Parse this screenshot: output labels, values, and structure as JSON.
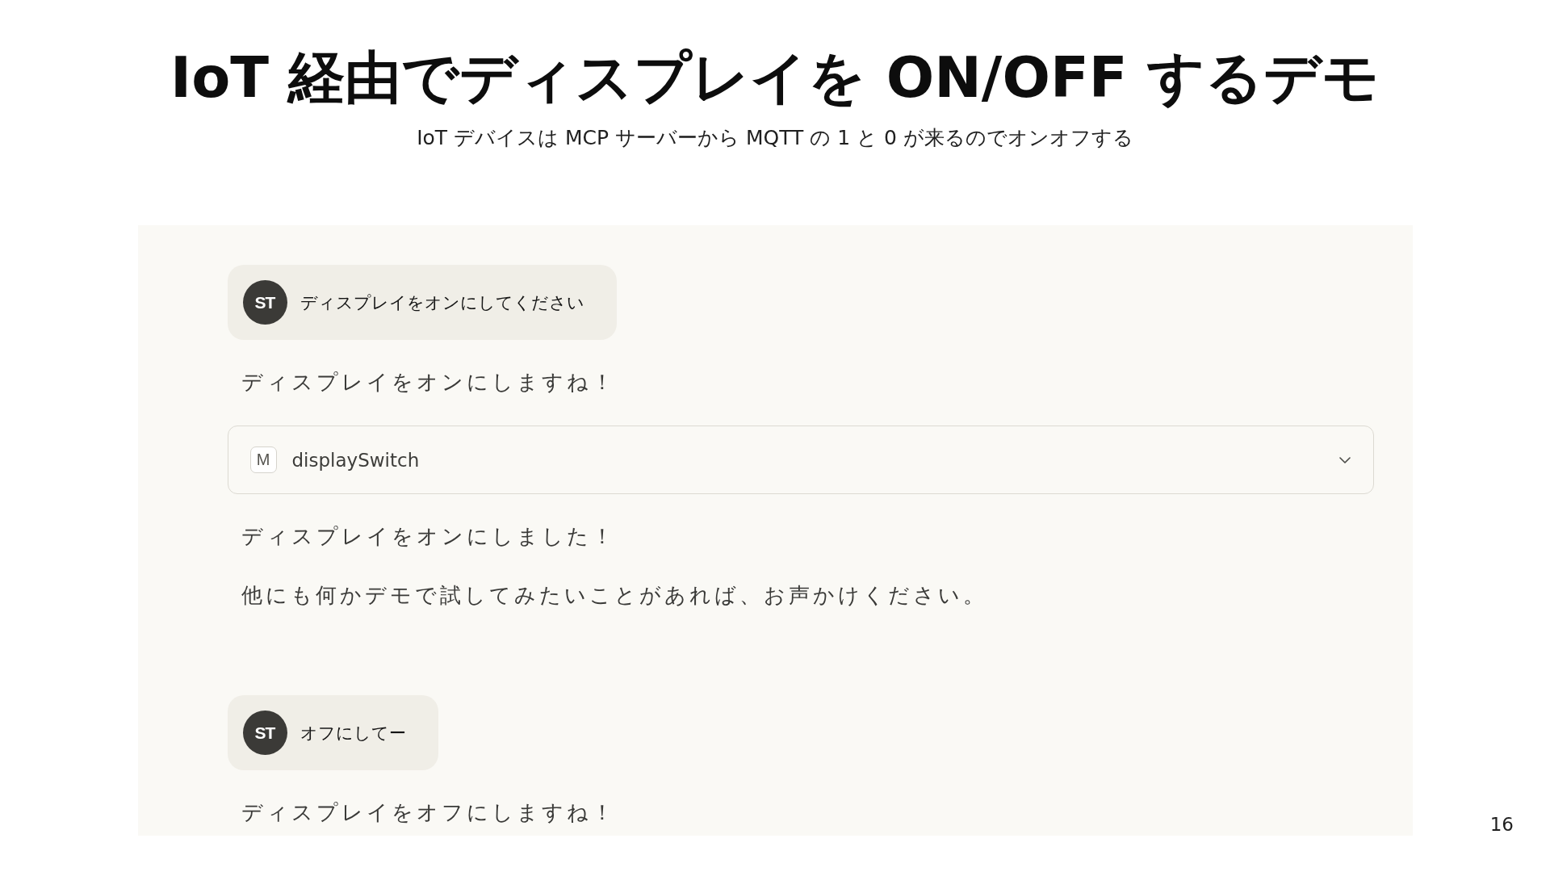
{
  "title": "IoT 経由でディスプレイを ON/OFF するデモ",
  "subtitle": "IoT デバイスは MCP サーバーから MQTT の 1 と 0 が来るのでオンオフする",
  "chat": {
    "messages": [
      {
        "kind": "user",
        "avatar": "ST",
        "text": "ディスプレイをオンにしてください"
      },
      {
        "kind": "assistant",
        "text": "ディスプレイをオンにしますね！"
      },
      {
        "kind": "tool",
        "icon": "M",
        "name": "displaySwitch",
        "expanded": false
      },
      {
        "kind": "assistant",
        "text": "ディスプレイをオンにしました！"
      },
      {
        "kind": "assistant",
        "text": "他にも何かデモで試してみたいことがあれば、お声かけください。"
      },
      {
        "kind": "user",
        "avatar": "ST",
        "text": "オフにしてー"
      },
      {
        "kind": "assistant",
        "text": "ディスプレイをオフにしますね！"
      }
    ]
  },
  "page_number": "16"
}
